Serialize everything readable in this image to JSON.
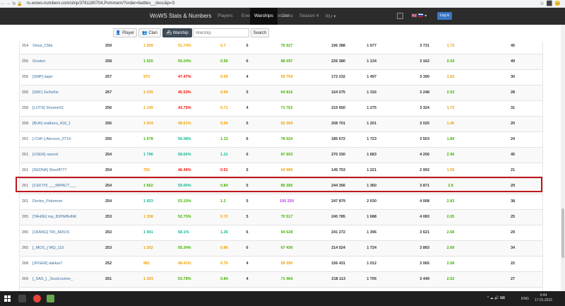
{
  "browser": {
    "url": "ru.wows-numbers.com/ship/3761190704,Pommern/?order=battles__desc&p=3"
  },
  "nav": {
    "brand": "WoWS Stats & Numbers",
    "links": [
      "Players",
      "Events",
      "Leaderboard",
      "Warships",
      "Clans",
      "Season 4",
      "RU ▾"
    ],
    "active": "Warships",
    "login": "Log in"
  },
  "search": {
    "player": "Player",
    "clan": "Clan",
    "warship": "Warship",
    "placeholder": "Warship",
    "button": "Search"
  },
  "colors": {
    "green": "#44b300",
    "lightgreen": "#4bbd1f",
    "teal": "#11b89a",
    "orange": "#f1a100",
    "red": "#fe0e00",
    "purple": "#c03ee7",
    "highlight": "#c0161c"
  },
  "rows": [
    {
      "rank": "254",
      "name": "Sirius_CMa",
      "battles": "259",
      "avg": "1 209",
      "wr": "51.74%",
      "kd": "0.7",
      "lvl": "5",
      "ad": "76 527",
      "dmg": "196 388",
      "kills": "1 677",
      "exp": "3 731",
      "planes": "1.73",
      "sv": "45",
      "c_avg": "#f1a100",
      "c_wr": "#f1a100",
      "c_kd": "#f1a100",
      "c_ad": "#44b300",
      "c_pl": "#f1a100"
    },
    {
      "rank": "255",
      "name": "Grodon",
      "battles": "258",
      "avg": "1 520",
      "wr": "55.04%",
      "kd": "0.95",
      "lvl": "6",
      "ad": "88 097",
      "dmg": "226 380",
      "kills": "1 134",
      "exp": "3 162",
      "planes": "2.04",
      "sv": "49",
      "c_avg": "#44b300",
      "c_wr": "#44b300",
      "c_kd": "#44b300",
      "c_ad": "#44b300",
      "c_pl": "#44b300"
    },
    {
      "rank": "256",
      "name": "[SMP] laqer",
      "battles": "257",
      "avg": "972",
      "wr": "47.47%",
      "kd": "0.69",
      "lvl": "4",
      "ad": "59 754",
      "dmg": "172 232",
      "kills": "1 497",
      "exp": "3 390",
      "planes": "1.62",
      "sv": "30",
      "c_avg": "#f1a100",
      "c_wr": "#fe0e00",
      "c_kd": "#f1a100",
      "c_ad": "#f1a100",
      "c_pl": "#f1a100"
    },
    {
      "rank": "256",
      "name": "[SRF] 2w3w5w",
      "battles": "257",
      "avg": "1 039",
      "wr": "45.53%",
      "kd": "0.69",
      "lvl": "5",
      "ad": "64 816",
      "dmg": "154 575",
      "kills": "1 316",
      "exp": "3 248",
      "planes": "2.53",
      "sv": "28",
      "c_avg": "#f1a100",
      "c_wr": "#fe0e00",
      "c_kd": "#f1a100",
      "c_ad": "#44b300",
      "c_pl": "#44b300"
    },
    {
      "rank": "258",
      "name": "[LOTS] Shumer01",
      "battles": "256",
      "avg": "1 149",
      "wr": "43.75%",
      "kd": "0.71",
      "lvl": "4",
      "ad": "71 762",
      "dmg": "215 650",
      "kills": "1 275",
      "exp": "3 324",
      "planes": "1.73",
      "sv": "31",
      "c_avg": "#f1a100",
      "c_wr": "#fe0e00",
      "c_kd": "#f1a100",
      "c_ad": "#44b300",
      "c_pl": "#f1a100"
    },
    {
      "rank": "258",
      "name": "[BUK] malboro_418_1",
      "battles": "256",
      "avg": "1 024",
      "wr": "49.61%",
      "kd": "0.66",
      "lvl": "5",
      "ad": "62 369",
      "dmg": "208 701",
      "kills": "1 201",
      "exp": "3 025",
      "planes": "1.46",
      "sv": "20",
      "c_avg": "#f1a100",
      "c_wr": "#f1a100",
      "c_kd": "#f1a100",
      "c_ad": "#f1a100",
      "c_pl": "#f1a100"
    },
    {
      "rank": "261",
      "name": "[-CHF-] Alexsun_0714",
      "battles": "255",
      "avg": "1 578",
      "wr": "56.08%",
      "kd": "1.13",
      "lvl": "6",
      "ad": "78 024",
      "dmg": "185 672",
      "kills": "1 723",
      "exp": "3 503",
      "planes": "1.89",
      "sv": "24",
      "c_avg": "#44b300",
      "c_wr": "#11b89a",
      "c_kd": "#44b300",
      "c_ad": "#44b300",
      "c_pl": "#44b300"
    },
    {
      "rank": "261",
      "name": "[USER] owzod",
      "battles": "254",
      "avg": "1 796",
      "wr": "58.66%",
      "kd": "1.21",
      "lvl": "6",
      "ad": "87 603",
      "dmg": "270 330",
      "kills": "1 683",
      "exp": "4 206",
      "planes": "2.96",
      "sv": "45",
      "c_avg": "#11b89a",
      "c_wr": "#11b89a",
      "c_kd": "#11b89a",
      "c_ad": "#44b300",
      "c_pl": "#44b300"
    },
    {
      "rank": "261",
      "name": "[SEDNA] Sheriff777",
      "battles": "254",
      "avg": "755",
      "wr": "46.46%",
      "kd": "0.51",
      "lvl": "5",
      "ad": "54 985",
      "dmg": "145 753",
      "kills": "1 221",
      "exp": "2 992",
      "planes": "1.59",
      "sv": "21",
      "c_avg": "#f1a100",
      "c_wr": "#fe0e00",
      "c_kd": "#fe0e00",
      "c_ad": "#f1a100",
      "c_pl": "#f1a100"
    },
    {
      "rank": "261",
      "name": "[CEKTP] ___IMPACT___",
      "battles": "254",
      "avg": "1 662",
      "wr": "59.06%",
      "kd": "0.84",
      "lvl": "5",
      "ad": "86 266",
      "dmg": "244 356",
      "kills": "1 360",
      "exp": "3 871",
      "planes": "2.8",
      "sv": "29",
      "c_avg": "#44b300",
      "c_wr": "#11b89a",
      "c_kd": "#44b300",
      "c_ad": "#44b300",
      "c_pl": "#44b300"
    },
    {
      "rank": "261",
      "name": "Doctor_Pokemon",
      "battles": "254",
      "avg": "1 923",
      "wr": "53.15%",
      "kd": "1.2",
      "lvl": "5",
      "ad": "100 259",
      "dmg": "247 879",
      "kills": "2 030",
      "exp": "4 008",
      "planes": "2.83",
      "sv": "38",
      "c_avg": "#11b89a",
      "c_wr": "#44b300",
      "c_kd": "#44b300",
      "c_ad": "#c03ee7",
      "c_pl": "#44b300"
    },
    {
      "rank": "265",
      "name": "[TAH0E] mp_B3PblBHNK",
      "battles": "253",
      "avg": "1 338",
      "wr": "52.75%",
      "kd": "0.72",
      "lvl": "5",
      "ad": "70 517",
      "dmg": "240 785",
      "kills": "1 688",
      "exp": "4 083",
      "planes": "2.05",
      "sv": "25",
      "c_avg": "#f1a100",
      "c_wr": "#44b300",
      "c_kd": "#f1a100",
      "c_ad": "#44b300",
      "c_pl": "#44b300"
    },
    {
      "rank": "265",
      "name": "[1RANG] TRI_ARIUS",
      "battles": "253",
      "avg": "1 941",
      "wr": "58.1%",
      "kd": "1.26",
      "lvl": "6",
      "ad": "94 628",
      "dmg": "241 272",
      "kills": "1 396",
      "exp": "3 621",
      "planes": "2.68",
      "sv": "29",
      "c_avg": "#11b89a",
      "c_wr": "#11b89a",
      "c_kd": "#11b89a",
      "c_ad": "#44b300",
      "c_pl": "#44b300"
    },
    {
      "rank": "265",
      "name": "[_MOS_] WQ_115",
      "battles": "253",
      "avg": "1 262",
      "wr": "55.34%",
      "kd": "0.86",
      "lvl": "6",
      "ad": "67 436",
      "dmg": "214 524",
      "kills": "1 724",
      "exp": "3 893",
      "planes": "2.69",
      "sv": "34",
      "c_avg": "#f1a100",
      "c_wr": "#44b300",
      "c_kd": "#f1a100",
      "c_ad": "#44b300",
      "c_pl": "#44b300"
    },
    {
      "rank": "268",
      "name": "[JPGER] dakkar7",
      "battles": "252",
      "avg": "981",
      "wr": "48.41%",
      "kd": "0.75",
      "lvl": "4",
      "ad": "59 390",
      "dmg": "156 431",
      "kills": "1 012",
      "exp": "3 065",
      "planes": "2.08",
      "sv": "22",
      "c_avg": "#f1a100",
      "c_wr": "#f1a100",
      "c_kd": "#f1a100",
      "c_ad": "#f1a100",
      "c_pl": "#44b300"
    },
    {
      "rank": "269",
      "name": "[_SAS_] _Soulcrusher_",
      "battles": "251",
      "avg": "1 324",
      "wr": "53.78%",
      "kd": "0.84",
      "lvl": "4",
      "ad": "71 464",
      "dmg": "218 113",
      "kills": "1 705",
      "exp": "3 449",
      "planes": "2.52",
      "sv": "27",
      "c_avg": "#f1a100",
      "c_wr": "#44b300",
      "c_kd": "#44b300",
      "c_ad": "#44b300",
      "c_pl": "#44b300"
    },
    {
      "rank": "269",
      "name": "[VMF] sir_Manguste",
      "battles": "251",
      "avg": "1 602",
      "wr": "59.16%",
      "kd": "1.02",
      "lvl": "6",
      "ad": "83 436",
      "dmg": "203 246",
      "kills": "1 488",
      "exp": "4 422",
      "planes": "3.66",
      "sv": "69",
      "c_avg": "#44b300",
      "c_wr": "#11b89a",
      "c_kd": "#44b300",
      "c_ad": "#44b300",
      "c_pl": "#44b300"
    },
    {
      "rank": "271",
      "name": "[KRONE] dkm_19",
      "battles": "250",
      "avg": "871",
      "wr": "46%",
      "kd": "0.48",
      "lvl": "5",
      "ad": "60 580",
      "dmg": "178 474",
      "kills": "1 131",
      "exp": "3 284",
      "planes": "1.3",
      "sv": "18",
      "c_avg": "#f1a100",
      "c_wr": "#fe0e00",
      "c_kd": "#fe0e00",
      "c_ad": "#f1a100",
      "c_pl": "#f1a100"
    }
  ],
  "taskbar": {
    "lang": "ENG",
    "time": "0:44",
    "date": "17.01.2022"
  }
}
